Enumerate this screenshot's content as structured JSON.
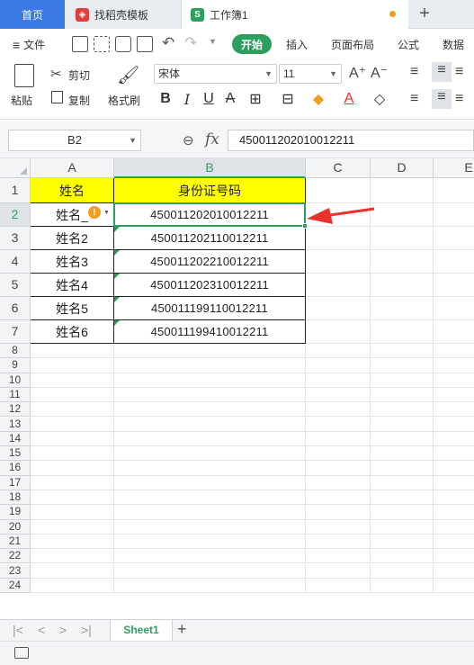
{
  "tabs": {
    "home": "首页",
    "template": "找稻壳模板",
    "workbook": "工作簿1",
    "new_tab": "+"
  },
  "menu": {
    "file": "文件",
    "start": "开始",
    "insert": "插入",
    "page_layout": "页面布局",
    "formula": "公式",
    "data": "数据"
  },
  "ribbon": {
    "paste": "粘贴",
    "cut": "剪切",
    "copy": "复制",
    "format_painter": "格式刷",
    "font_name": "宋体",
    "font_size": "11",
    "bold": "B",
    "italic": "I",
    "underline": "U",
    "strike": "A"
  },
  "formula_bar": {
    "name_box": "B2",
    "fx": "fx",
    "value": "450011202010012211"
  },
  "columns": [
    "A",
    "B",
    "C",
    "D",
    "E"
  ],
  "rows": [
    "1",
    "2",
    "3",
    "4",
    "5",
    "6",
    "7",
    "8",
    "9",
    "10",
    "11",
    "12",
    "13",
    "14",
    "15",
    "16",
    "17",
    "18",
    "19",
    "20",
    "21",
    "22",
    "23",
    "24"
  ],
  "table": {
    "header": {
      "a": "姓名",
      "b": "身份证号码"
    },
    "records": [
      {
        "name": "姓名_",
        "id": "450011202010012211"
      },
      {
        "name": "姓名2",
        "id": "450011202110012211"
      },
      {
        "name": "姓名3",
        "id": "450011202210012211"
      },
      {
        "name": "姓名4",
        "id": "450011202310012211"
      },
      {
        "name": "姓名5",
        "id": "450011199110012211"
      },
      {
        "name": "姓名6",
        "id": "450011199410012211"
      }
    ]
  },
  "sheet": {
    "name": "Sheet1",
    "add": "+"
  },
  "colors": {
    "accent": "#2c9f5f",
    "header_fill": "#ffff00",
    "tab_active": "#3b79e4",
    "arrow": "#e8322b",
    "warning": "#f0a020"
  }
}
